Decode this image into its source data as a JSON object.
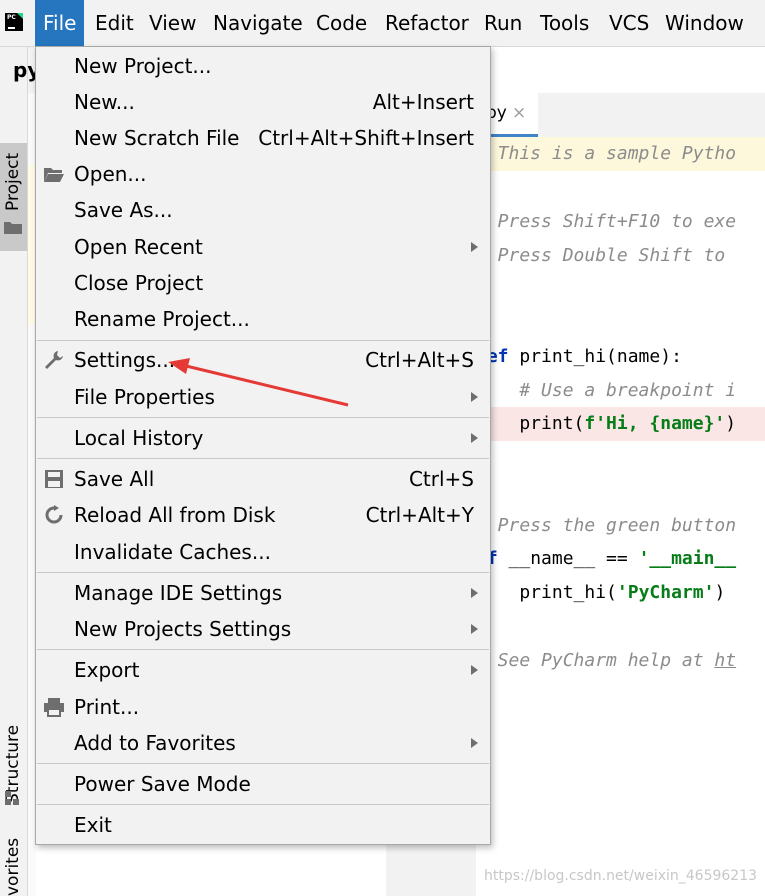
{
  "menubar": {
    "items": [
      "File",
      "Edit",
      "View",
      "Navigate",
      "Code",
      "Refactor",
      "Run",
      "Tools",
      "VCS",
      "Window"
    ],
    "logo_text": "PC"
  },
  "toolstrip": {
    "project_label": "Project",
    "structure_label": "Structure",
    "favorites_label": "vorites"
  },
  "project": {
    "title": "py"
  },
  "editor": {
    "tab_label": "py",
    "tab_close": "×",
    "lines": [
      "# This is a sample Pytho",
      "# Press Shift+F10 to exe",
      "# Press Double Shift to ",
      "def",
      " print_hi(name):",
      "    # Use a breakpoint i",
      "    print(",
      "f'Hi, {name}'",
      ")",
      "# Press the green button",
      "if",
      " __name__ == ",
      "'__main__",
      "    print_hi(",
      "'PyCharm'",
      ")",
      "# See PyCharm help at ",
      "ht"
    ]
  },
  "file_menu": {
    "items": [
      {
        "label": "New Project...",
        "shortcut": ""
      },
      {
        "label": "New...",
        "shortcut": "Alt+Insert"
      },
      {
        "label": "New Scratch File",
        "shortcut": "Ctrl+Alt+Shift+Insert"
      },
      {
        "label": "Open...",
        "shortcut": ""
      },
      {
        "label": "Save As...",
        "shortcut": ""
      },
      {
        "label": "Open Recent",
        "shortcut": ""
      },
      {
        "label": "Close Project",
        "shortcut": ""
      },
      {
        "label": "Rename Project...",
        "shortcut": ""
      },
      {
        "label": "Settings...",
        "shortcut": "Ctrl+Alt+S"
      },
      {
        "label": "File Properties",
        "shortcut": ""
      },
      {
        "label": "Local History",
        "shortcut": ""
      },
      {
        "label": "Save All",
        "shortcut": "Ctrl+S"
      },
      {
        "label": "Reload All from Disk",
        "shortcut": "Ctrl+Alt+Y"
      },
      {
        "label": "Invalidate Caches...",
        "shortcut": ""
      },
      {
        "label": "Manage IDE Settings",
        "shortcut": ""
      },
      {
        "label": "New Projects Settings",
        "shortcut": ""
      },
      {
        "label": "Export",
        "shortcut": ""
      },
      {
        "label": "Print...",
        "shortcut": ""
      },
      {
        "label": "Add to Favorites",
        "shortcut": ""
      },
      {
        "label": "Power Save Mode",
        "shortcut": ""
      },
      {
        "label": "Exit",
        "shortcut": ""
      }
    ]
  },
  "colors": {
    "menu_active": "#2675bf",
    "annotation_arrow": "#e53935",
    "menu_bg": "#f2f2f2"
  },
  "watermark": "https://blog.csdn.net/weixin_46596213"
}
